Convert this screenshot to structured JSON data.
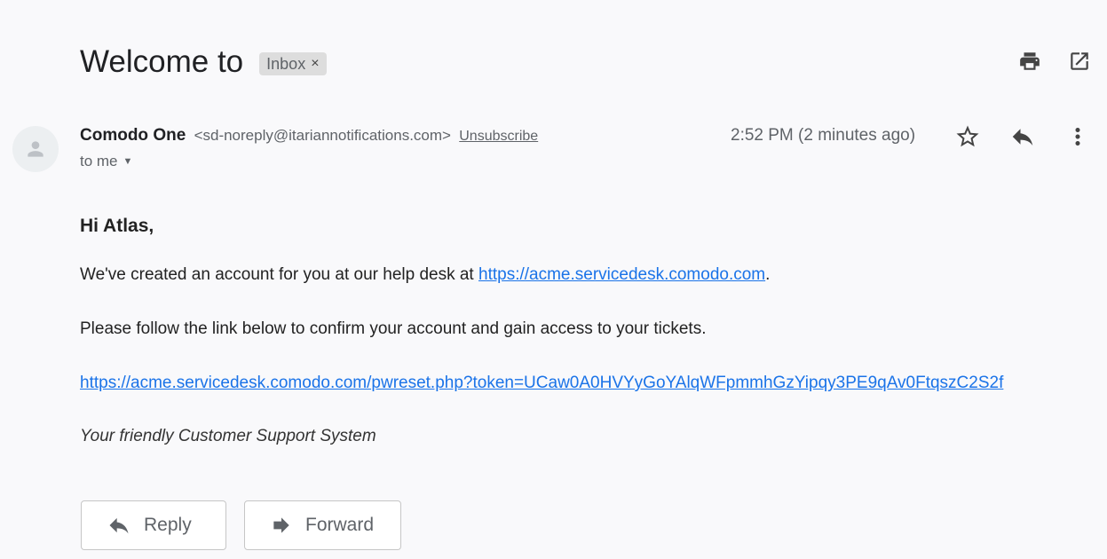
{
  "subject": {
    "title": "Welcome to",
    "label": "Inbox",
    "label_close": "×"
  },
  "message": {
    "sender_name": "Comodo One",
    "sender_email": "<sd-noreply@itariannotifications.com>",
    "unsubscribe": "Unsubscribe",
    "to": "to me",
    "time": "2:52 PM (2 minutes ago)"
  },
  "body": {
    "greeting": "Hi Atlas,",
    "p1_prefix": "We've created an account for you at our help desk at ",
    "p1_link": "https://acme.servicedesk.comodo.com",
    "p1_suffix": ".",
    "p2": "Please follow the link below to confirm your account and gain access to your tickets.",
    "reset_link": "https://acme.servicedesk.comodo.com/pwreset.php?token=UCaw0A0HVYyGoYAlqWFpmmhGzYipqy3PE9qAv0FtqszC2S2f",
    "signature": "Your friendly Customer Support System"
  },
  "actions": {
    "reply": "Reply",
    "forward": "Forward"
  },
  "icons": {
    "print": "print-icon",
    "open_new_window": "open-in-new-window-icon",
    "avatar": "person-icon",
    "star": "star-icon",
    "reply": "reply-icon",
    "more": "more-vert-icon",
    "forward": "forward-icon"
  },
  "colors": {
    "link": "#1a73e8",
    "icon": "#5f6368",
    "background": "#f9f9fb"
  }
}
